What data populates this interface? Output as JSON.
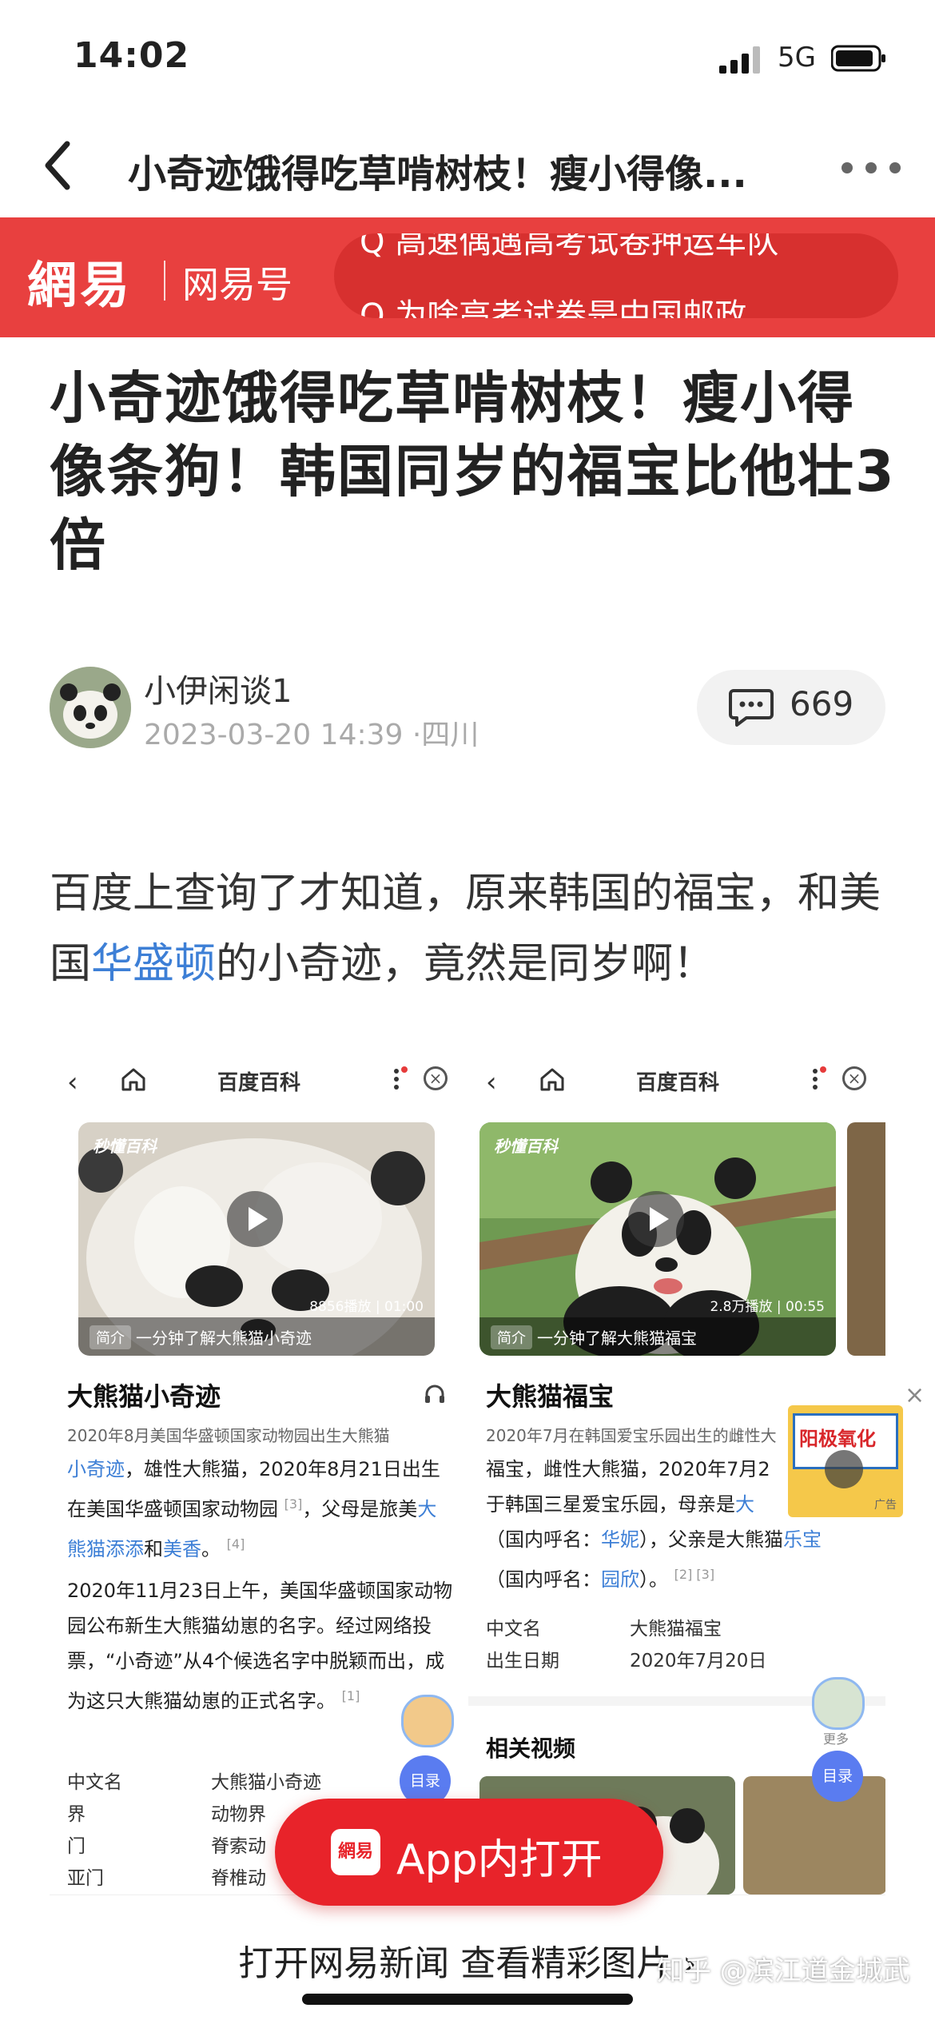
{
  "status_bar": {
    "time": "14:02",
    "network": "5G"
  },
  "nav": {
    "title": "小奇迹饿得吃草啃树枝！瘦小得像..."
  },
  "brand": {
    "logo": "網易",
    "subtitle": "网易号",
    "search_lines": [
      "Q 高速偶遇高考试卷押运车队",
      "Q 为啥高考试卷是中国邮政"
    ]
  },
  "article": {
    "headline": "小奇迹饿得吃草啃树枝！瘦小得像条狗！韩国同岁的福宝比他壮3倍",
    "author": "小伊闲谈1",
    "meta": "2023-03-20 14:39 ·四川",
    "comment_count": "669",
    "para_before": "百度上查询了才知道，原来韩国的福宝，和美国",
    "para_link": "华盛顿",
    "para_after": "的小奇迹，竟然是同岁啊！"
  },
  "screenshot": {
    "left": {
      "top_title": "百度百科",
      "video_logo": "秒懂百科",
      "video_stats": "8856播放 | 01:00",
      "video_tag": "简介",
      "video_caption": "一分钟了解大熊猫小奇迹",
      "name": "大熊猫小奇迹",
      "desc": "2020年8月美国华盛顿国家动物园出生大熊猫",
      "body_1": "小奇迹",
      "body_2": "，雄性大熊猫，2020年8月21日出生在美国华盛顿国家动物园",
      "body_3": "[3]",
      "body_4": "，父母是旅美",
      "body_5": "大熊猫添添",
      "body_6": "和",
      "body_7": "美香",
      "body_8": "。",
      "body_9": "[4]",
      "body2": "2020年11月23日上午，美国华盛顿国家动物园公布新生大熊猫幼崽的名字。经过网络投票，“小奇迹”从4个候选名字中脱颖而出，成为这只大熊猫幼崽的正式名字。",
      "body2_sup": "[1]",
      "kv": [
        {
          "k": "中文名",
          "v": "大熊猫小奇迹"
        },
        {
          "k": "界",
          "v": "动物界"
        },
        {
          "k": "门",
          "v": "脊索动"
        },
        {
          "k": "亚门",
          "v": "脊椎动"
        }
      ],
      "toc": "目录"
    },
    "right": {
      "top_title": "百度百科",
      "video_logo": "秒懂百科",
      "video_stats": "2.8万播放 | 00:55",
      "video_tag": "简介",
      "video_caption": "一分钟了解大熊猫福宝",
      "name": "大熊猫福宝",
      "desc": "2020年7月在韩国爱宝乐园出生的雌性大",
      "body_1": "福宝，雌性大熊猫，2020年7月2",
      "body_2": "于韩国三星爱宝乐园，母亲是",
      "body_3": "大",
      "body_4": "（国内呼名：",
      "body_5": "华妮",
      "body_6": "），父亲是大熊猫",
      "body_7": "乐宝",
      "body_8": "（国内呼名：",
      "body_9": "园欣",
      "body_10": "）。",
      "body_11": "[2] [3]",
      "kv": [
        {
          "k": "中文名",
          "v": "大熊猫福宝"
        },
        {
          "k": "出生日期",
          "v": "2020年7月20日"
        }
      ],
      "related": "相关视频",
      "toc": "目录",
      "tag_more": "更多"
    }
  },
  "ad": {
    "text": "阳极氧化",
    "label": "广告"
  },
  "app_button": {
    "logo": "網易",
    "label": "App内打开"
  },
  "bottom": {
    "link": "打开网易新闻 查看精彩图片 ›",
    "watermark": "知乎 @滨江道金城武"
  },
  "colors": {
    "brand_red": "#e8403f",
    "button_red": "#e8232a",
    "link_blue": "#3d7fd6"
  }
}
